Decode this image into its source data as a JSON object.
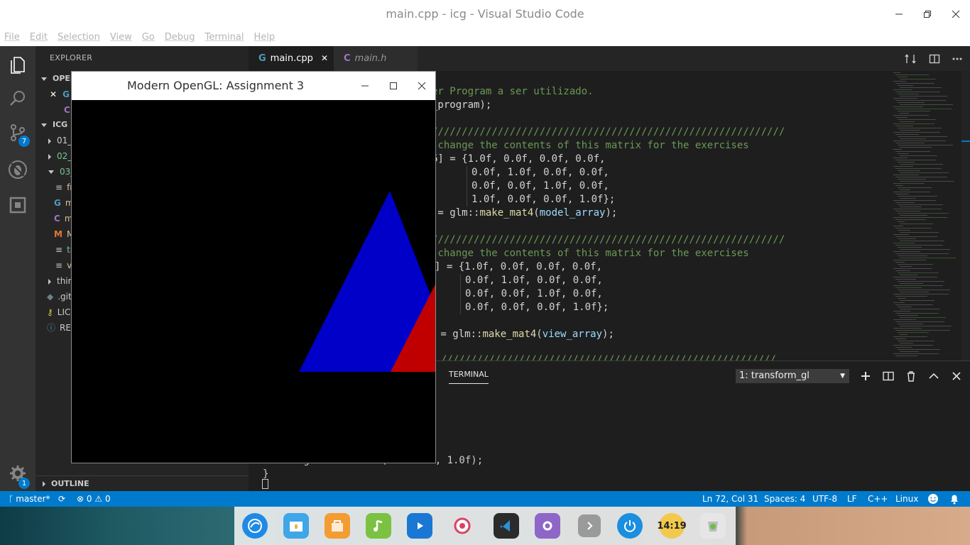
{
  "window": {
    "title": "main.cpp - icg - Visual Studio Code"
  },
  "menu": [
    "File",
    "Edit",
    "Selection",
    "View",
    "Go",
    "Debug",
    "Terminal",
    "Help"
  ],
  "activity": {
    "scm_badge": "7",
    "settings_badge": "1"
  },
  "sidebar": {
    "header": "EXPLORER",
    "open_editors_label": "OPEN",
    "open_items": [
      "G",
      "C"
    ],
    "section": "ICG",
    "items": [
      {
        "label": "01_",
        "kind": "folder"
      },
      {
        "label": "02_",
        "kind": "folder"
      },
      {
        "label": "03_",
        "kind": "folder-open"
      },
      {
        "label": "fr",
        "kind": "file"
      },
      {
        "label": "m",
        "kind": "file"
      },
      {
        "label": "m",
        "kind": "file"
      },
      {
        "label": "M",
        "kind": "file"
      },
      {
        "label": "tr",
        "kind": "file"
      },
      {
        "label": "ve",
        "kind": "file"
      },
      {
        "label": "thir",
        "kind": "folder"
      },
      {
        "label": ".git",
        "kind": "file"
      },
      {
        "label": "LIC",
        "kind": "file"
      },
      {
        "label": "RE",
        "kind": "file"
      }
    ],
    "outline": "OUTLINE"
  },
  "tabs": [
    {
      "label": "main.cpp",
      "active": true
    },
    {
      "label": "main.h",
      "active": false
    }
  ],
  "code": {
    "l1": "er Program a ser utilizado.",
    "l2": "_program);",
    "l3": "///////////////////////////////////////////////////////////",
    "l4": " change the contents of this matrix for the exercises",
    "l5a": "6] = {",
    "l5b": "1.0f, 0.0f, 0.0f, 0.0f,",
    "l6": "0.0f, 1.0f, 0.0f, 0.0f,",
    "l7": "0.0f, 0.0f, 1.0f, 0.0f,",
    "l8": "1.0f, 0.0f, 0.0f, 1.0f};",
    "l9a": " = glm::",
    "l9b": "make_mat4",
    "l9c": "(",
    "l9d": "model_array",
    "l9e": ");",
    "l10": "///////////////////////////////////////////////////////////",
    "l11": " change the contents of this matrix for the exercises",
    "l12": "] = {1.0f, 0.0f, 0.0f, 0.0f,",
    "l13": "0.0f, 1.0f, 0.0f, 0.0f,",
    "l14": "0.0f, 0.0f, 1.0f, 0.0f,",
    "l15": "0.0f, 0.0f, 0.0f, 1.0f};",
    "l16a": " = glm::",
    "l16b": "make_mat4",
    "l16c": "(",
    "l16d": "view_array",
    "l16e": ");",
    "l17": "n ////////////////////////////////////////////////////////"
  },
  "panel": {
    "tab": "TERMINAL",
    "terminal_select": "1: transform_gl",
    "line1": "FragColor = vec4(outColor, 1.0f);",
    "line2": "}"
  },
  "gl_window": {
    "title": "Modern OpenGL: Assignment 3"
  },
  "status": {
    "branch": "master*",
    "errors": "0",
    "warnings": "0",
    "position": "Ln 72, Col 31",
    "spaces": "Spaces: 4",
    "encoding": "UTF-8",
    "eol": "LF",
    "language": "C++",
    "platform": "Linux"
  },
  "dock": {
    "apps": [
      "deepin-launcher-icon",
      "file-manager-icon",
      "app-store-icon",
      "music-icon",
      "video-icon",
      "settings-icon",
      "vscode-icon",
      "system-settings-icon",
      "more-icon",
      "power-icon",
      "clock-icon",
      "trash-icon"
    ],
    "clock_text": "14:19"
  },
  "colors": {
    "accent": "#007acc",
    "triangle_blue": "#0000c8",
    "triangle_red": "#c00000"
  }
}
